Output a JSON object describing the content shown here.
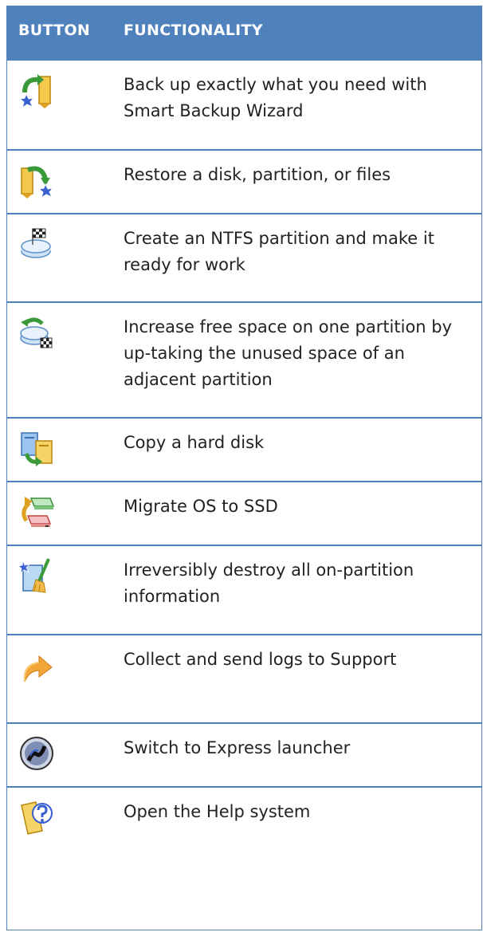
{
  "header": {
    "col_button": "BUTTON",
    "col_function": "FUNCTIONALITY"
  },
  "rows": [
    {
      "icon": "backup-wizard-icon",
      "text": "Back up exactly what you need with Smart Backup Wizard"
    },
    {
      "icon": "restore-icon",
      "text": "Restore a disk, partition, or files"
    },
    {
      "icon": "create-partition-icon",
      "text": "Create an NTFS partition and make it ready for work"
    },
    {
      "icon": "redistribute-space-icon",
      "text": "Increase free space on one partition by up-taking the unused space of an adjacent partition"
    },
    {
      "icon": "copy-disk-icon",
      "text": "Copy a hard disk"
    },
    {
      "icon": "migrate-os-icon",
      "text": "Migrate OS to SSD"
    },
    {
      "icon": "wipe-partition-icon",
      "text": "Irreversibly destroy all on-partition information"
    },
    {
      "icon": "send-logs-icon",
      "text": "Collect and send logs to Support"
    },
    {
      "icon": "express-launcher-icon",
      "text": "Switch to Express launcher"
    },
    {
      "icon": "help-icon",
      "text": "Open the Help system"
    }
  ]
}
